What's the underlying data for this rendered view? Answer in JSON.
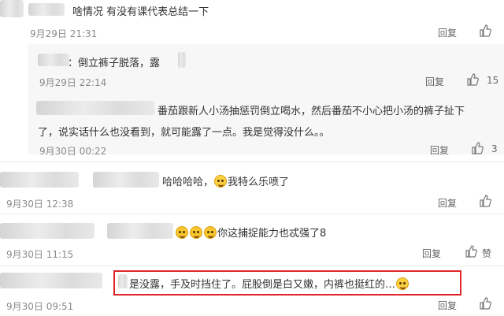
{
  "comments": [
    {
      "text": "啥情况 有没有课代表总结一下",
      "time": "9月29日 21:31",
      "reply": "回复",
      "likes": ""
    },
    {
      "text": "：倒立裤子脱落，露",
      "time": "9月29日 22:14",
      "reply": "回复",
      "likes": "15"
    },
    {
      "text_line1": "番茄跟新人小汤抽惩罚倒立喝水，然后番茄不小心把小汤的裤子扯下",
      "text_line2": "了，说实话什么也没看到，就可能露了一点。我是觉得没什么。。",
      "time": "9月30日 00:22",
      "reply": "回复",
      "likes": "3"
    },
    {
      "text_a": "哈哈哈哈，",
      "text_b": "我特么乐喷了",
      "time": "9月30日 12:38",
      "reply": "回复",
      "likes": ""
    },
    {
      "text": "你这捕捉能力也忒强了8",
      "time": "9月30日 11:15",
      "reply": "回复",
      "likes": "赞"
    },
    {
      "text": "是没露，手及时挡住了。屁股倒是白又嫩，内裤也挺红的…",
      "time": "9月30日 09:51",
      "reply": "回复",
      "likes": ""
    }
  ],
  "colors": {
    "highlight": "#e0262b",
    "reply_bg": "#f7f7f7"
  },
  "icons": {
    "like": "thumbs-up-icon",
    "emoji": "laughing-emoji-icon"
  }
}
